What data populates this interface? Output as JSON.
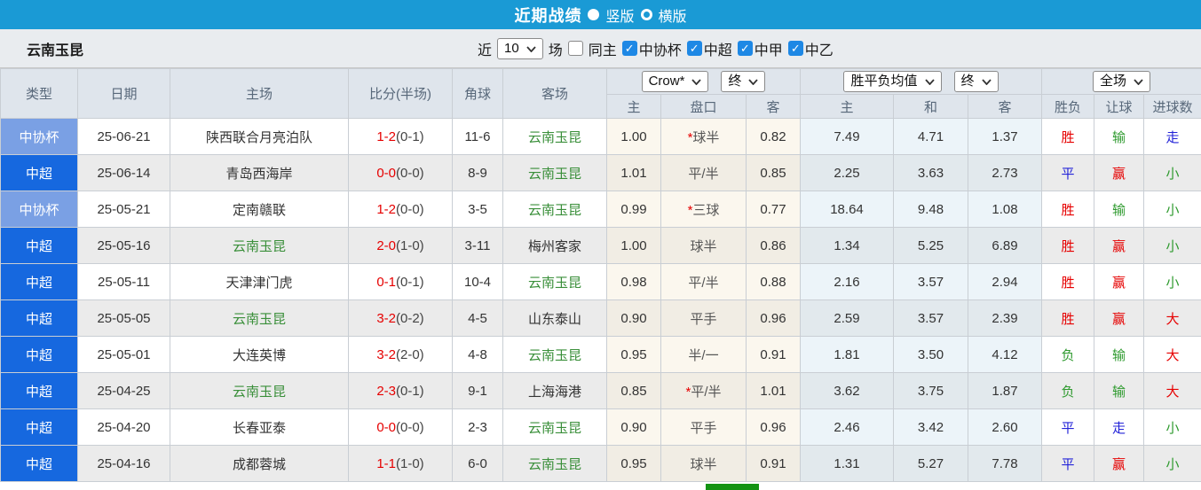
{
  "titlebar": {
    "title": "近期战绩",
    "vertical_label": "竖版",
    "vertical_selected": true,
    "horizontal_label": "横版",
    "horizontal_selected": false
  },
  "filterbar": {
    "team": "云南玉昆",
    "recent_label": "近",
    "recent_count": "10",
    "matches_label": "场",
    "same_home_label": "同主",
    "same_home_checked": false,
    "leagues": [
      {
        "label": "中协杯",
        "checked": true
      },
      {
        "label": "中超",
        "checked": true
      },
      {
        "label": "中甲",
        "checked": true
      },
      {
        "label": "中乙",
        "checked": true
      }
    ]
  },
  "header": {
    "type": "类型",
    "date": "日期",
    "home": "主场",
    "score": "比分(半场)",
    "corner": "角球",
    "away": "客场",
    "odds_company": "Crow*",
    "odds_stage": "终",
    "avg_type": "胜平负均值",
    "avg_stage": "终",
    "scope": "全场",
    "sub": {
      "odds_home": "主",
      "handicap": "盘口",
      "odds_away": "客",
      "avg_home": "主",
      "avg_draw": "和",
      "avg_away": "客",
      "result": "胜负",
      "handicap_result": "让球",
      "goals": "进球数"
    }
  },
  "rows": [
    {
      "type": "中协杯",
      "date": "25-06-21",
      "home": "陕西联合月亮泊队",
      "score": "1-2",
      "half": "0-1",
      "corner": "11-6",
      "away": "云南玉昆",
      "odds_home": "1.00",
      "handicap": "*球半",
      "odds_away": "0.82",
      "avg_home": "7.49",
      "avg_draw": "4.71",
      "avg_away": "1.37",
      "result": "胜",
      "handicap_result": "输",
      "goals": "走"
    },
    {
      "type": "中超",
      "date": "25-06-14",
      "home": "青岛西海岸",
      "score": "0-0",
      "half": "0-0",
      "corner": "8-9",
      "away": "云南玉昆",
      "odds_home": "1.01",
      "handicap": "平/半",
      "odds_away": "0.85",
      "avg_home": "2.25",
      "avg_draw": "3.63",
      "avg_away": "2.73",
      "result": "平",
      "handicap_result": "赢",
      "goals": "小"
    },
    {
      "type": "中协杯",
      "date": "25-05-21",
      "home": "定南赣联",
      "score": "1-2",
      "half": "0-0",
      "corner": "3-5",
      "away": "云南玉昆",
      "odds_home": "0.99",
      "handicap": "*三球",
      "odds_away": "0.77",
      "avg_home": "18.64",
      "avg_draw": "9.48",
      "avg_away": "1.08",
      "result": "胜",
      "handicap_result": "输",
      "goals": "小"
    },
    {
      "type": "中超",
      "date": "25-05-16",
      "home": "云南玉昆",
      "score": "2-0",
      "half": "1-0",
      "corner": "3-11",
      "away": "梅州客家",
      "odds_home": "1.00",
      "handicap": "球半",
      "odds_away": "0.86",
      "avg_home": "1.34",
      "avg_draw": "5.25",
      "avg_away": "6.89",
      "result": "胜",
      "handicap_result": "赢",
      "goals": "小"
    },
    {
      "type": "中超",
      "date": "25-05-11",
      "home": "天津津门虎",
      "score": "0-1",
      "half": "0-1",
      "corner": "10-4",
      "away": "云南玉昆",
      "odds_home": "0.98",
      "handicap": "平/半",
      "odds_away": "0.88",
      "avg_home": "2.16",
      "avg_draw": "3.57",
      "avg_away": "2.94",
      "result": "胜",
      "handicap_result": "赢",
      "goals": "小"
    },
    {
      "type": "中超",
      "date": "25-05-05",
      "home": "云南玉昆",
      "score": "3-2",
      "half": "0-2",
      "corner": "4-5",
      "away": "山东泰山",
      "odds_home": "0.90",
      "handicap": "平手",
      "odds_away": "0.96",
      "avg_home": "2.59",
      "avg_draw": "3.57",
      "avg_away": "2.39",
      "result": "胜",
      "handicap_result": "赢",
      "goals": "大"
    },
    {
      "type": "中超",
      "date": "25-05-01",
      "home": "大连英博",
      "score": "3-2",
      "half": "2-0",
      "corner": "4-8",
      "away": "云南玉昆",
      "odds_home": "0.95",
      "handicap": "半/一",
      "odds_away": "0.91",
      "avg_home": "1.81",
      "avg_draw": "3.50",
      "avg_away": "4.12",
      "result": "负",
      "handicap_result": "输",
      "goals": "大"
    },
    {
      "type": "中超",
      "date": "25-04-25",
      "home": "云南玉昆",
      "score": "2-3",
      "half": "0-1",
      "corner": "9-1",
      "away": "上海海港",
      "odds_home": "0.85",
      "handicap": "*平/半",
      "odds_away": "1.01",
      "avg_home": "3.62",
      "avg_draw": "3.75",
      "avg_away": "1.87",
      "result": "负",
      "handicap_result": "输",
      "goals": "大"
    },
    {
      "type": "中超",
      "date": "25-04-20",
      "home": "长春亚泰",
      "score": "0-0",
      "half": "0-0",
      "corner": "2-3",
      "away": "云南玉昆",
      "odds_home": "0.90",
      "handicap": "平手",
      "odds_away": "0.96",
      "avg_home": "2.46",
      "avg_draw": "3.42",
      "avg_away": "2.60",
      "result": "平",
      "handicap_result": "走",
      "goals": "小"
    },
    {
      "type": "中超",
      "date": "25-04-16",
      "home": "成都蓉城",
      "score": "1-1",
      "half": "1-0",
      "corner": "6-0",
      "away": "云南玉昆",
      "odds_home": "0.95",
      "handicap": "球半",
      "odds_away": "0.91",
      "avg_home": "1.31",
      "avg_draw": "5.27",
      "avg_away": "7.78",
      "result": "平",
      "handicap_result": "赢",
      "goals": "小"
    }
  ],
  "colors": {
    "topbar": "#1a9ad5",
    "csl_badge": "#1668df",
    "cup_badge": "#7aa0e4",
    "win_red": "#e60000",
    "draw_blue": "#2323d8",
    "lose_green": "#2e9a2e",
    "focus_team_green": "#3a8f3a",
    "checkbox_blue": "#1e88e5",
    "bottom_bar_green": "#139313"
  }
}
